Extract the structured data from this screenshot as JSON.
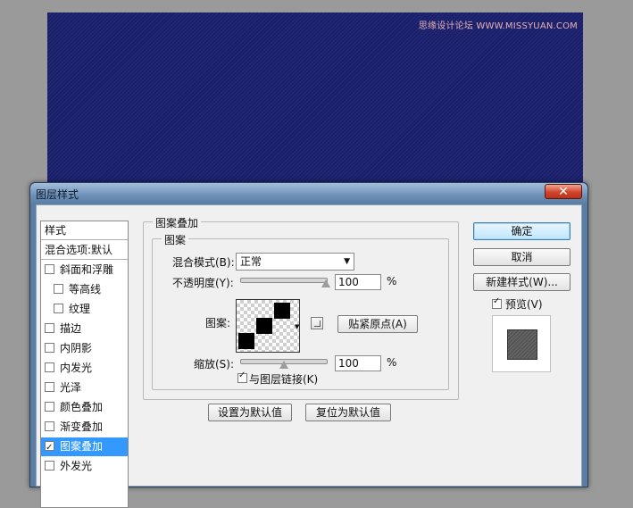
{
  "watermark": "思缘设计论坛 WWW.MISSYUAN.COM",
  "dialog": {
    "title": "图层样式",
    "close_label": "✕"
  },
  "style_list": {
    "header": "样式",
    "blend_options": "混合选项:默认",
    "items": [
      {
        "label": "斜面和浮雕",
        "checked": false,
        "indent": false
      },
      {
        "label": "等高线",
        "checked": false,
        "indent": true
      },
      {
        "label": "纹理",
        "checked": false,
        "indent": true
      },
      {
        "label": "描边",
        "checked": false,
        "indent": false
      },
      {
        "label": "内阴影",
        "checked": false,
        "indent": false
      },
      {
        "label": "内发光",
        "checked": false,
        "indent": false
      },
      {
        "label": "光泽",
        "checked": false,
        "indent": false
      },
      {
        "label": "颜色叠加",
        "checked": false,
        "indent": false
      },
      {
        "label": "渐变叠加",
        "checked": false,
        "indent": false
      },
      {
        "label": "图案叠加",
        "checked": true,
        "indent": false,
        "selected": true
      },
      {
        "label": "外发光",
        "checked": false,
        "indent": false
      }
    ]
  },
  "pattern_overlay": {
    "section_title": "图案叠加",
    "group_title": "图案",
    "blend_mode_label": "混合模式(B):",
    "blend_mode_value": "正常",
    "opacity_label": "不透明度(Y):",
    "opacity_value": "100",
    "opacity_unit": "%",
    "opacity_level": 100,
    "pattern_label": "图案:",
    "snap_origin_label": "贴紧原点(A)",
    "scale_label": "缩放(S):",
    "scale_value": "100",
    "scale_unit": "%",
    "link_layer_label": "与图层链接(K)",
    "link_layer_checked": true,
    "set_default_label": "设置为默认值",
    "reset_default_label": "复位为默认值"
  },
  "buttons": {
    "ok": "确定",
    "cancel": "取消",
    "new_style": "新建样式(W)...",
    "preview_label": "预览(V)",
    "preview_checked": true
  },
  "colors": {
    "canvas": "#1a1f6c",
    "selected": "#3399ff"
  }
}
